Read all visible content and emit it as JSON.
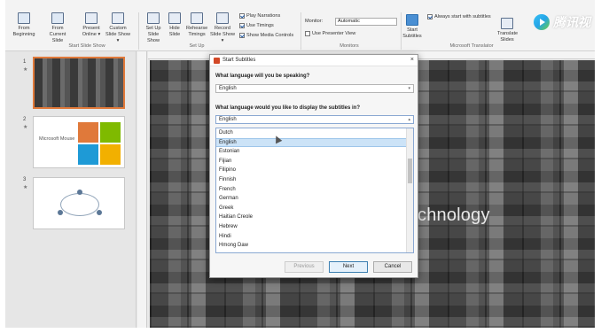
{
  "ribbon": {
    "buttons": [
      {
        "label": "From Beginning",
        "icon": "from-beginning-icon"
      },
      {
        "label": "From Current Slide",
        "icon": "from-current-slide-icon"
      },
      {
        "label": "Present Online ▾",
        "icon": "present-online-icon"
      },
      {
        "label": "Custom Slide Show ▾",
        "icon": "custom-slide-show-icon"
      },
      {
        "label": "Set Up Slide Show",
        "icon": "set-up-slide-show-icon"
      },
      {
        "label": "Hide Slide",
        "icon": "hide-slide-icon"
      },
      {
        "label": "Rehearse Timings",
        "icon": "rehearse-timings-icon"
      },
      {
        "label": "Record Slide Show ▾",
        "icon": "record-slide-show-icon"
      }
    ],
    "checks": [
      {
        "label": "Play Narrations",
        "checked": true
      },
      {
        "label": "Use Timings",
        "checked": true
      },
      {
        "label": "Show Media Controls",
        "checked": true
      }
    ],
    "monitor_label": "Monitor:",
    "monitor_value": "Automatic",
    "presenter_view": "Use Presenter View",
    "start_subtitles": "Start Subtitles",
    "always_start": "Always start with subtitles",
    "translate_slides": "Translate Slides",
    "groups": [
      "Start Slide Show",
      "Set Up",
      "Monitors",
      "Microsoft Translator"
    ]
  },
  "watermark": "腾讯视",
  "thumbnails": [
    {
      "num": "1",
      "caption": ""
    },
    {
      "num": "2",
      "title": "Microsoft Mouse",
      "subtitle": ""
    },
    {
      "num": "3",
      "label": ""
    }
  ],
  "slide": {
    "text": "chnology"
  },
  "dialog": {
    "title": "Start Subtitles",
    "close": "×",
    "q1": "What language will you be speaking?",
    "spoken": "English",
    "q2": "What language would you like to display the subtitles in?",
    "display": "English",
    "options": [
      "Dutch",
      "English",
      "Estonian",
      "Fijian",
      "Filipino",
      "Finnish",
      "French",
      "German",
      "Greek",
      "Haitian Creole",
      "Hebrew",
      "Hindi",
      "Hmong Daw"
    ],
    "selected_index": 1,
    "btn_previous": "Previous",
    "btn_next": "Next",
    "btn_cancel": "Cancel"
  },
  "colors": {
    "accent": "#d24726",
    "selection": "#cce3f7",
    "thumb_selected": "#e0793a"
  }
}
